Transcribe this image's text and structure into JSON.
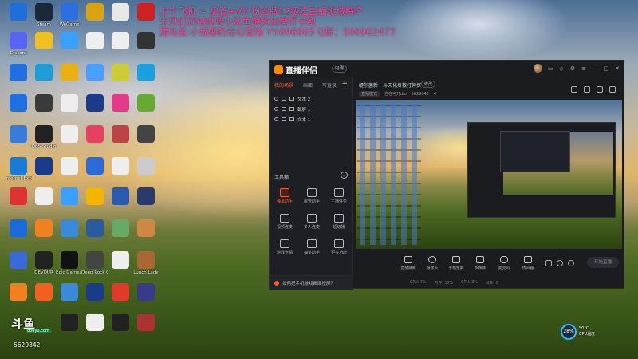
{
  "overlay": {
    "line1": "上个飞机 = 房管+VX 粉丝牌12级送主播地域特产",
    "line2": "宝贝们记得投喂小鲨鱼跟粉丝牌打卡哟",
    "line3": "游戏名:小缇娜的奇幻冒险 YY:898665 Q群：560902477"
  },
  "desktop_icons": [
    {
      "label": "",
      "color": "#1e6fd9",
      "col": 0,
      "row": 0
    },
    {
      "label": "Steam",
      "color": "#1b2838",
      "col": 1,
      "row": 0
    },
    {
      "label": "WeGame",
      "color": "#2b6fe0",
      "col": 2,
      "row": 0
    },
    {
      "label": "",
      "color": "#d9a30f",
      "col": 3,
      "row": 0
    },
    {
      "label": "",
      "color": "#e8e8e8",
      "col": 4,
      "row": 0
    },
    {
      "label": "",
      "color": "#c22",
      "col": 5,
      "row": 0
    },
    {
      "label": "Discord",
      "color": "#5865f2",
      "col": 0,
      "row": 1
    },
    {
      "label": "",
      "color": "#f0c020",
      "col": 1,
      "row": 1
    },
    {
      "label": "",
      "color": "#3aa0ff",
      "col": 2,
      "row": 1
    },
    {
      "label": "",
      "color": "#eee",
      "col": 3,
      "row": 1
    },
    {
      "label": "",
      "color": "#eee",
      "col": 4,
      "row": 1
    },
    {
      "label": "",
      "color": "#333",
      "col": 5,
      "row": 1
    },
    {
      "label": "",
      "color": "#1f6fe0",
      "col": 0,
      "row": 2
    },
    {
      "label": "",
      "color": "#1f9dd9",
      "col": 1,
      "row": 2
    },
    {
      "label": "",
      "color": "#e8b010",
      "col": 2,
      "row": 2
    },
    {
      "label": "",
      "color": "#4aa0ff",
      "col": 3,
      "row": 2
    },
    {
      "label": "",
      "color": "#cc3",
      "col": 4,
      "row": 2
    },
    {
      "label": "",
      "color": "#1aa0e0",
      "col": 5,
      "row": 2
    },
    {
      "label": "",
      "color": "#1f6fe0",
      "col": 0,
      "row": 3
    },
    {
      "label": "",
      "color": "#3a3a3a",
      "col": 1,
      "row": 3
    },
    {
      "label": "",
      "color": "#eee",
      "col": 2,
      "row": 3
    },
    {
      "label": "",
      "color": "#1a3a8a",
      "col": 3,
      "row": 3
    },
    {
      "label": "",
      "color": "#e43a8a",
      "col": 4,
      "row": 3
    },
    {
      "label": "",
      "color": "#6a3",
      "col": 5,
      "row": 3
    },
    {
      "label": "",
      "color": "#3a7ad9",
      "col": 0,
      "row": 4
    },
    {
      "label": "OBS Studio",
      "color": "#222",
      "col": 1,
      "row": 4
    },
    {
      "label": "",
      "color": "#eee",
      "col": 2,
      "row": 4
    },
    {
      "label": "",
      "color": "#e84060",
      "col": 3,
      "row": 4
    },
    {
      "label": "",
      "color": "#b44",
      "col": 4,
      "row": 4
    },
    {
      "label": "",
      "color": "#444",
      "col": 5,
      "row": 4
    },
    {
      "label": "Internet Explorer",
      "color": "#1a7ad9",
      "col": 0,
      "row": 5
    },
    {
      "label": "",
      "color": "#1a3a8a",
      "col": 1,
      "row": 5
    },
    {
      "label": "",
      "color": "#eee",
      "col": 2,
      "row": 5
    },
    {
      "label": "",
      "color": "#2a6ad9",
      "col": 3,
      "row": 5
    },
    {
      "label": "",
      "color": "#eee",
      "col": 4,
      "row": 5
    },
    {
      "label": "",
      "color": "#ccc",
      "col": 5,
      "row": 5
    },
    {
      "label": "",
      "color": "#d33",
      "col": 0,
      "row": 6
    },
    {
      "label": "",
      "color": "#eee",
      "col": 1,
      "row": 6
    },
    {
      "label": "",
      "color": "#3aa0ff",
      "col": 2,
      "row": 6
    },
    {
      "label": "",
      "color": "#f4b400",
      "col": 3,
      "row": 6
    },
    {
      "label": "",
      "color": "#2a5ab0",
      "col": 4,
      "row": 6
    },
    {
      "label": "",
      "color": "#2a3a6a",
      "col": 5,
      "row": 6
    },
    {
      "label": "",
      "color": "#1a6ad9",
      "col": 0,
      "row": 7
    },
    {
      "label": "",
      "color": "#f08020",
      "col": 1,
      "row": 7
    },
    {
      "label": "",
      "color": "#3a8ad9",
      "col": 2,
      "row": 7
    },
    {
      "label": "",
      "color": "#2a5aa0",
      "col": 3,
      "row": 7
    },
    {
      "label": "",
      "color": "#6a6",
      "col": 4,
      "row": 7
    },
    {
      "label": "",
      "color": "#c84",
      "col": 5,
      "row": 7
    },
    {
      "label": "",
      "color": "#3a6ad9",
      "col": 0,
      "row": 8
    },
    {
      "label": "DEVOUR",
      "color": "#222",
      "col": 1,
      "row": 8
    },
    {
      "label": "Epic Games Launcher",
      "color": "#111",
      "col": 2,
      "row": 8
    },
    {
      "label": "Deep Rock Galactic",
      "color": "#444",
      "col": 3,
      "row": 8
    },
    {
      "label": "",
      "color": "#eee",
      "col": 4,
      "row": 8
    },
    {
      "label": "Lunch Lady",
      "color": "#a63",
      "col": 5,
      "row": 8
    },
    {
      "label": "",
      "color": "#f08020",
      "col": 0,
      "row": 9
    },
    {
      "label": "",
      "color": "#f06020",
      "col": 1,
      "row": 9
    },
    {
      "label": "",
      "color": "#3a8ad9",
      "col": 2,
      "row": 9
    },
    {
      "label": "",
      "color": "#1a3a8a",
      "col": 3,
      "row": 9
    },
    {
      "label": "",
      "color": "#e03a2a",
      "col": 4,
      "row": 9
    },
    {
      "label": "",
      "color": "#3a3a8a",
      "col": 5,
      "row": 9
    },
    {
      "label": "",
      "color": "#222",
      "col": 2,
      "row": 10
    },
    {
      "label": "",
      "color": "#eee",
      "col": 3,
      "row": 10
    },
    {
      "label": "",
      "color": "#222",
      "col": 4,
      "row": 10
    },
    {
      "label": "",
      "color": "#a33",
      "col": 5,
      "row": 10
    }
  ],
  "app": {
    "logo": "直播伴侣",
    "badge": "内测",
    "tabs": [
      "我的场景",
      "画面",
      "写直录"
    ],
    "sources": [
      "文本 2",
      "截屏 1",
      "文本 1"
    ],
    "tools_header": "工具箱",
    "tools": [
      {
        "label": "弹幕助手",
        "active": true
      },
      {
        "label": "房管助手",
        "active": false
      },
      {
        "label": "主播任务",
        "active": false
      },
      {
        "label": "视频连麦",
        "active": false
      },
      {
        "label": "多人连麦",
        "active": false
      },
      {
        "label": "超级播",
        "active": false
      },
      {
        "label": "游戏竞猜",
        "active": false
      },
      {
        "label": "抽奖助手",
        "active": false
      },
      {
        "label": "更多功能",
        "active": false
      }
    ],
    "notice": "如何把手机游戏画面投屏？",
    "room_title": "缇尔菌新一斗天化身救打神探",
    "room_tag": "修改",
    "room_meta": [
      "直播模式",
      "自在可开dlo",
      "5629842",
      "4"
    ],
    "bottom_buttons": [
      "直播屏幕",
      "摄像头",
      "手机投屏",
      "多媒体",
      "麦克风",
      "扬声器"
    ],
    "start_button": "开始直播",
    "status": [
      "CPU: 7%",
      "内存: 38%",
      "GPU: 3%",
      "帧率: 0"
    ]
  },
  "widgets": {
    "cpu_percent": "28%",
    "cpu_temp": "50°C",
    "cpu_label": "CPU温度",
    "corner_mark": "斗鱼",
    "corner_site": "douyu.com",
    "room_id": "5629842"
  }
}
